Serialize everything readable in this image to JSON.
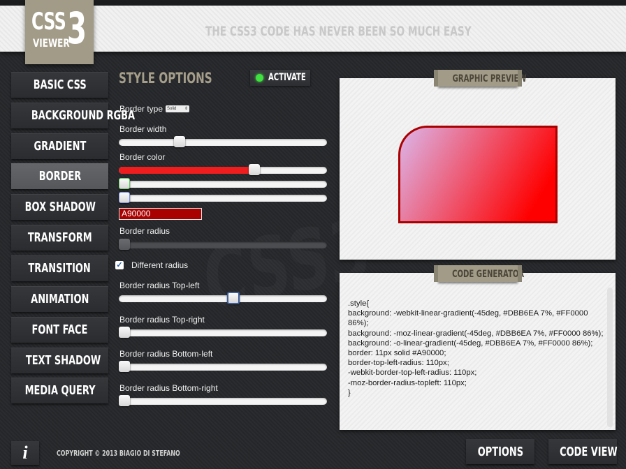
{
  "app": {
    "logo": {
      "css": "CSS",
      "viewer": "VIEWER",
      "version": "3"
    },
    "tagline": "THE CSS3 CODE HAS NEVER BEEN SO MUCH EASY"
  },
  "sidebar": {
    "items": [
      {
        "label": "BASIC CSS",
        "active": false
      },
      {
        "label": "BACKGROUND RGBA",
        "active": false
      },
      {
        "label": "GRADIENT",
        "active": false
      },
      {
        "label": "BORDER",
        "active": true
      },
      {
        "label": "BOX SHADOW",
        "active": false
      },
      {
        "label": "TRANSFORM",
        "active": false
      },
      {
        "label": "TRANSITION",
        "active": false
      },
      {
        "label": "ANIMATION",
        "active": false
      },
      {
        "label": "FONT FACE",
        "active": false
      },
      {
        "label": "TEXT SHADOW",
        "active": false
      },
      {
        "label": "MEDIA QUERY",
        "active": false
      }
    ]
  },
  "style_options": {
    "title": "STYLE OPTIONS",
    "activate_label": "ACTIVATE",
    "activate_status_color": "#3fe03f",
    "border_type": {
      "label": "Border type",
      "value": "Solid"
    },
    "border_width": {
      "label": "Border width",
      "value_fraction": 0.28
    },
    "border_color": {
      "label": "Border color",
      "red_fraction": 0.66,
      "green_fraction": 0.0,
      "blue_fraction": 0.0,
      "hex_value": "A90000",
      "red_fill_color": "#ef1d1d"
    },
    "border_radius": {
      "label": "Border radius",
      "value_fraction": 0.0,
      "enabled": false
    },
    "different_radius": {
      "label": "Different radius",
      "checked": true
    },
    "radius_top_left": {
      "label": "Border radius Top-left",
      "value_fraction": 0.55
    },
    "radius_top_right": {
      "label": "Border radius Top-right",
      "value_fraction": 0.0
    },
    "radius_bottom_left": {
      "label": "Border radius Bottom-left",
      "value_fraction": 0.0
    },
    "radius_bottom_right": {
      "label": "Border radius Bottom-right",
      "value_fraction": 0.0
    }
  },
  "graphic_preview": {
    "title": "GRAPHIC PREVIEW",
    "shape_border_color": "#A90000",
    "gradient_start": "#DBB6EA",
    "gradient_end": "#FF0000"
  },
  "code_generator": {
    "title": "CODE GENERATOR",
    "code": ".style{\nbackground: -webkit-linear-gradient(-45deg, #DBB6EA 7%, #FF0000 86%);\nbackground: -moz-linear-gradient(-45deg, #DBB6EA 7%, #FF0000 86%);\nbackground: -o-linear-gradient(-45deg, #DBB6EA 7%, #FF0000 86%);\nborder: 11px solid #A90000;\nborder-top-left-radius: 110px;\n-webkit-border-top-left-radius: 110px;\n-moz-border-radius-topleft: 110px;\n}"
  },
  "footer": {
    "info_icon": "i",
    "copyright": "COPYRIGHT © 2013 BIAGIO DI STEFANO",
    "options_label": "OPTIONS",
    "code_view_label": "CODE VIEW"
  },
  "colors": {
    "accent_tan": "#A29B88",
    "background_dark": "#26282B"
  }
}
